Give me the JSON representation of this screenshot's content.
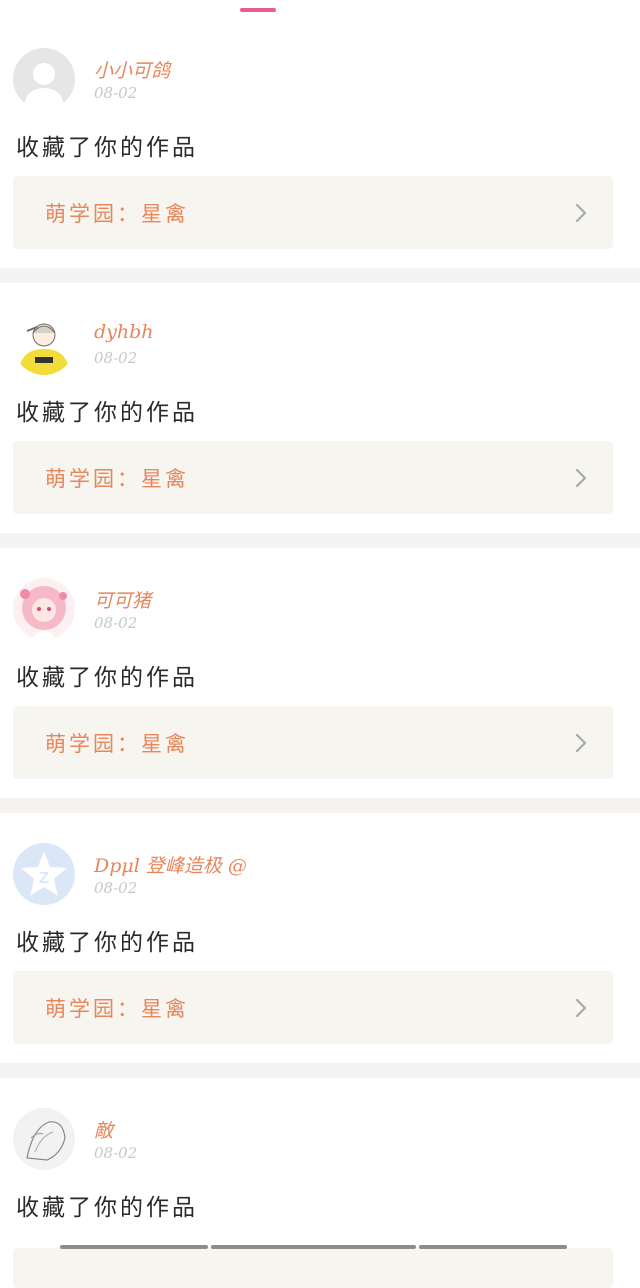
{
  "feed": [
    {
      "username": "小小可鸽",
      "date": "08-02",
      "action": "收藏了你的作品",
      "work": "萌学园：星禽",
      "avatar": "default-avatar-icon"
    },
    {
      "username": "dyhbh",
      "date": "08-02",
      "action": "收藏了你的作品",
      "work": "萌学园：星禽",
      "avatar": "yellow-hoodie-avatar"
    },
    {
      "username": "可可猪",
      "date": "08-02",
      "action": "收藏了你的作品",
      "work": "萌学园：星禽",
      "avatar": "pink-girl-avatar"
    },
    {
      "username": "Dpμl 登峰造极 @",
      "date": "08-02",
      "action": "收藏了你的作品",
      "work": "萌学园：星禽",
      "avatar": "qzone-star-avatar"
    },
    {
      "username": "敵",
      "date": "08-02",
      "action": "收藏了你的作品",
      "work": "",
      "avatar": "sketch-avatar"
    }
  ],
  "colors": {
    "accent": "#e85c94",
    "name": "#e8865a",
    "date": "#c8c8c8",
    "card_box": "#f6f5f0"
  }
}
